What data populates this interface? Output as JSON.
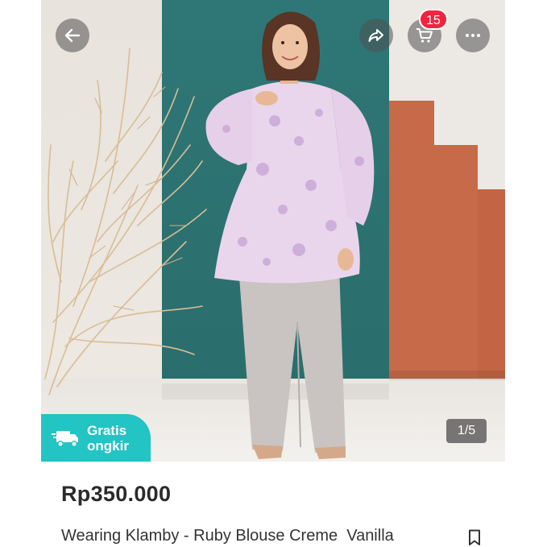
{
  "header": {
    "back_icon": "arrow-left-icon",
    "share_icon": "share-arrow-icon",
    "cart_icon": "cart-icon",
    "cart_count": "15",
    "more_icon": "more-dots-icon"
  },
  "gallery": {
    "counter": "1/5"
  },
  "promo": {
    "icon": "truck-icon",
    "line1": "Gratis",
    "line2": "ongkir",
    "color": "#22c4c4"
  },
  "product": {
    "price": "Rp350.000",
    "title": "Wearing Klamby - Ruby Blouse Creme  Vanilla",
    "bookmark_icon": "bookmark-icon"
  },
  "colors": {
    "badge": "#f3233f",
    "teal_backdrop": "#2f7777",
    "terracotta": "#c66a4a"
  }
}
